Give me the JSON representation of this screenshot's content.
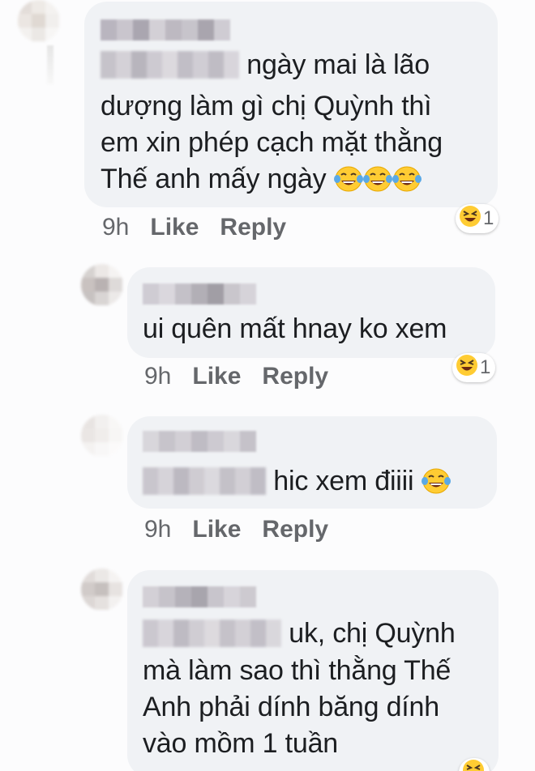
{
  "comments": [
    {
      "text_after_blur": "ngày mai là lão",
      "text_lines": [
        "dượng làm gì chị Quỳnh thì",
        "em xin phép cạch mặt thằng",
        "Thế anh mấy ngày"
      ],
      "emoji": "laughing-tears",
      "emoji_count_inline": 3,
      "time": "9h",
      "like": "Like",
      "reply": "Reply",
      "reaction_count": "1"
    },
    {
      "text": "ui quên mất hnay ko xem",
      "time": "9h",
      "like": "Like",
      "reply": "Reply",
      "reaction_count": "1"
    },
    {
      "text_after_blur": "hic xem điiii",
      "emoji": "laughing-tears",
      "time": "9h",
      "like": "Like",
      "reply": "Reply"
    },
    {
      "text_after_blur": "uk, chị Quỳnh",
      "text_lines": [
        "mà làm sao thì thằng Thế",
        "Anh phải dính băng dính",
        "vào mồm 1 tuần"
      ]
    }
  ],
  "colors": {
    "bubble": "#f0f2f5",
    "text": "#1c1e21",
    "meta": "#65676b"
  },
  "icons": {
    "reaction": "laughing-squint-emoji",
    "inline": "tears-of-joy-emoji"
  }
}
